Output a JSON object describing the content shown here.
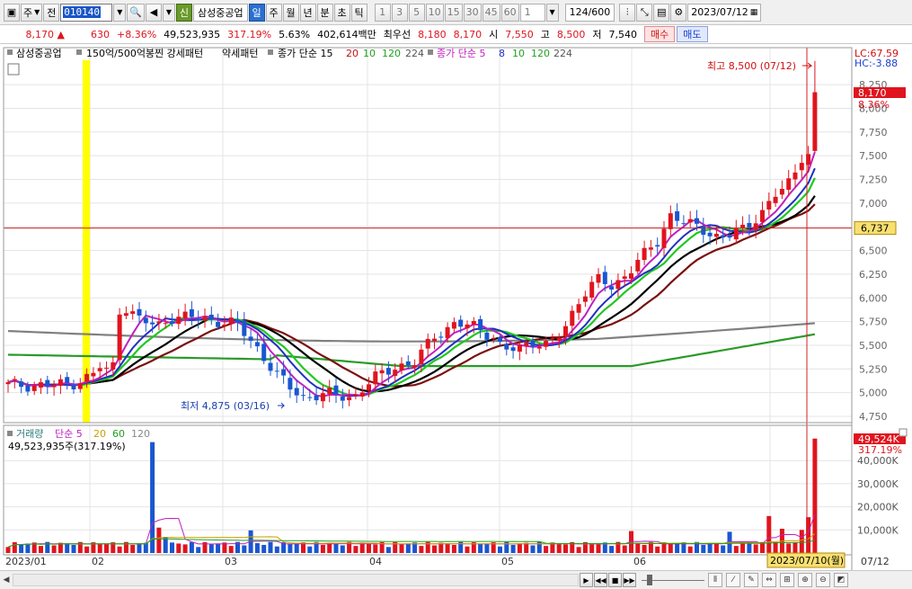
{
  "toolbar": {
    "mode_label": "주",
    "prev_label": "전",
    "code_value": "010140",
    "shin_label": "신",
    "stock_name": "삼성중공업",
    "periods": [
      "일",
      "주",
      "월",
      "년",
      "분",
      "초",
      "틱"
    ],
    "selected_period": "일",
    "intervals": [
      "1",
      "3",
      "5",
      "10",
      "15",
      "30",
      "45",
      "60"
    ],
    "interval_value": "1",
    "count": "124",
    "count_total": "/600",
    "date": "2023/07/12"
  },
  "info": {
    "price": "8,170",
    "change": "630",
    "change_pct": "+8.36%",
    "volume": "49,523,935",
    "volume_ratio": "317.19%",
    "turnover": "5.63%",
    "amount": "402,614백만",
    "bid_label": "최우선",
    "ask_price": "8,180",
    "bid_price": "8,170",
    "open_label": "시",
    "open": "7,550",
    "high_label": "고",
    "high": "8,500",
    "low_label": "저",
    "low": "7,540",
    "buy_label": "매수",
    "sell_label": "매도"
  },
  "legend": {
    "stock": "삼성중공업",
    "pattern1": "150억/500억봉찐 강세패턴",
    "pattern2": "약세패턴",
    "ma_label1": "종가 단순 15",
    "ma1": [
      "20",
      "10",
      "120",
      "224"
    ],
    "ma_label2": "종가 단순 5",
    "ma2": [
      "8",
      "10",
      "120",
      "224"
    ],
    "vol_label": "거래량",
    "vol_ma_label": "단순 5",
    "vol_ma": [
      "20",
      "60",
      "120"
    ],
    "vol_readout": "49,523,935주(317.19%)"
  },
  "annotations": {
    "high": "최고 8,500 (07/12)",
    "low": "최저 4,875 (03/16)",
    "lc": "LC:67.59",
    "hc": "HC:-3.88",
    "price_tag": "8,170",
    "pct_tag": "8.36%",
    "hline_tag": "6,737",
    "vol_tag": "49,524K",
    "vol_pct_tag": "317.19%",
    "cursor_date": "2023/07/10(월)"
  },
  "colors": {
    "up": "#e0141e",
    "down": "#1a56d0",
    "ma5": "#c020c0",
    "ma8": "#2030c0",
    "ma10": "#20c820",
    "ma20": "#000000",
    "ma40": "#7a1010",
    "ma120": "#2a9a2a",
    "ma224": "#808080"
  },
  "chart_data": {
    "type": "candlestick",
    "ylim": [
      4750,
      8500
    ],
    "y_ticks": [
      "8,250",
      "8,000",
      "7,750",
      "7,500",
      "7,250",
      "7,000",
      "6,750",
      "6,500",
      "6,250",
      "6,000",
      "5,750",
      "5,500",
      "5,250",
      "5,000",
      "4,750"
    ],
    "vol_ticks": [
      "40,000K",
      "30,000K",
      "20,000K",
      "10,000K"
    ],
    "x_labels": [
      "2023/01",
      "02",
      "03",
      "04",
      "05",
      "06",
      "07/12"
    ],
    "hline": 6737
  }
}
